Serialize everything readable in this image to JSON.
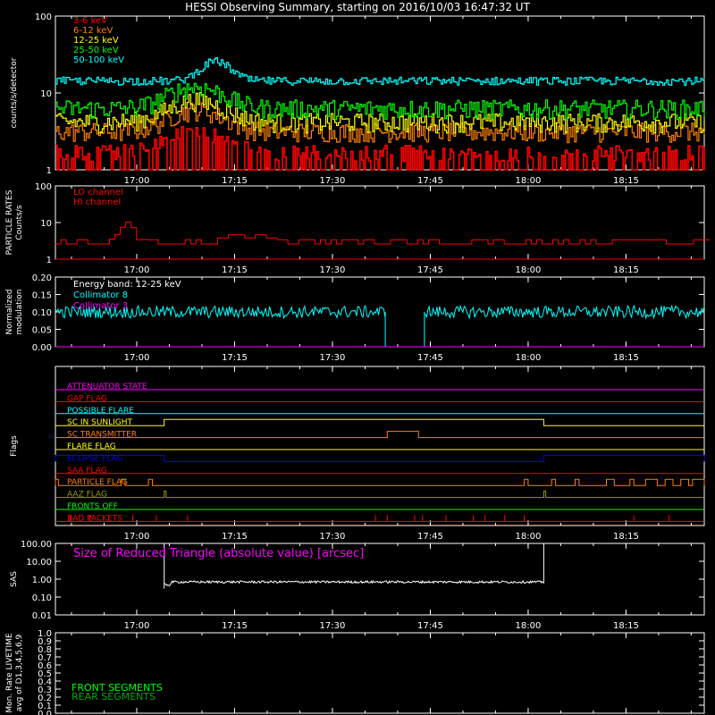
{
  "title": "HESSI Observing Summary, starting on 2016/10/03 16:47:32 UT",
  "time_ticks": [
    "17:00",
    "17:15",
    "17:30",
    "17:45",
    "18:00",
    "18:15"
  ],
  "colors": {
    "axis": "#ffffff",
    "red": "#ff0000",
    "orange": "#ff8000",
    "yellow": "#ffff00",
    "green": "#00ff00",
    "cyan": "#00ffff",
    "magenta": "#ff00ff",
    "blue": "#0000ff",
    "darkgreen": "#00aa00",
    "olive": "#999900"
  },
  "chart_data": [
    {
      "id": "counts",
      "type": "line",
      "ylabel": "counts/s/detector",
      "yscale": "log",
      "ylim": [
        1,
        100
      ],
      "yticks": [
        "1",
        "10",
        "100"
      ],
      "legend": [
        "3-6 keV",
        "6-12 keV",
        "12-25 keV",
        "25-50 keV",
        "50-100 keV"
      ],
      "series": [
        {
          "name": "3-6 keV",
          "color": "#ff0000",
          "base": 1.6
        },
        {
          "name": "6-12 keV",
          "color": "#ff8000",
          "base": 3.0
        },
        {
          "name": "12-25 keV",
          "color": "#ffff00",
          "base": 4.0
        },
        {
          "name": "25-50 keV",
          "color": "#00ff00",
          "base": 6.0
        },
        {
          "name": "50-100 keV",
          "color": "#00ffff",
          "base": 14.0
        }
      ]
    },
    {
      "id": "particle",
      "type": "line",
      "ylabel": "PARTICLE RATES",
      "ylabel2": "Counts/s",
      "yscale": "log",
      "ylim": [
        1,
        100
      ],
      "yticks": [
        "1",
        "10",
        "100"
      ],
      "legend": [
        "LO channel",
        "HI channel"
      ],
      "series": [
        {
          "name": "LO channel",
          "color": "#ff0000",
          "base": 2.4
        },
        {
          "name": "HI channel",
          "color": "#ff0000",
          "base": 1.0
        }
      ]
    },
    {
      "id": "modulation",
      "type": "line",
      "ylabel": "Normalized",
      "ylabel2": "modulation",
      "ylim": [
        0,
        0.2
      ],
      "yticks": [
        "0.00",
        "0.05",
        "0.10",
        "0.15",
        "0.20"
      ],
      "legend": [
        "Energy band: 12-25 keV",
        "Collimator 8",
        "Collimator 3"
      ],
      "series": [
        {
          "name": "Collimator 8",
          "color": "#00ffff",
          "base": 0.1
        },
        {
          "name": "Collimator 3",
          "color": "#ff00ff",
          "base": 0.0
        }
      ]
    },
    {
      "id": "flags",
      "type": "line",
      "ylabel": "Flags",
      "series": [
        {
          "name": "ATTENUATOR STATE",
          "color": "#ff00ff",
          "steps": []
        },
        {
          "name": "GAP FLAG",
          "color": "#ff0000",
          "steps": []
        },
        {
          "name": "POSSIBLE FLARE",
          "color": "#00ffff",
          "steps": []
        },
        {
          "name": "SC IN SUNLIGHT",
          "color": "#ffff00",
          "steps": [
            [
              17.07,
              18.04
            ]
          ]
        },
        {
          "name": "SC TRANSMITTER",
          "color": "#ff8000",
          "steps": [
            [
              17.64,
              17.72
            ]
          ]
        },
        {
          "name": "FLARE FLAG",
          "color": "#ffff00",
          "steps": []
        },
        {
          "name": "ECLIPSE FLAG",
          "color": "#0000ff",
          "steps": [
            [
              16.79,
              17.07
            ],
            [
              18.04,
              18.45
            ]
          ]
        },
        {
          "name": "SAA FLAG",
          "color": "#ff0000",
          "steps": []
        },
        {
          "name": "PARTICLE FLAG",
          "color": "#ff8000",
          "steps": [
            [
              16.79,
              16.8
            ],
            [
              16.96,
              16.97
            ],
            [
              17.03,
              17.04
            ],
            [
              17.99,
              18.0
            ],
            [
              18.06,
              18.07
            ],
            [
              18.12,
              18.13
            ],
            [
              18.2,
              18.22
            ],
            [
              18.26,
              18.27
            ],
            [
              18.3,
              18.33
            ],
            [
              18.35,
              18.37
            ],
            [
              18.39,
              18.41
            ],
            [
              18.42,
              18.45
            ]
          ]
        },
        {
          "name": "AAZ FLAG",
          "color": "#999900",
          "steps": [
            [
              17.07,
              17.075
            ],
            [
              18.04,
              18.045
            ]
          ]
        },
        {
          "name": "FRONTS OFF",
          "color": "#00ff00",
          "steps": []
        },
        {
          "name": "BAD PACKETS",
          "color": "#ff0000",
          "spikes": [
            16.83,
            16.88,
            16.99,
            17.05,
            17.13,
            17.61,
            17.64,
            17.71,
            17.73,
            17.79,
            17.86,
            17.89,
            17.94,
            17.99,
            18.27,
            18.36
          ]
        }
      ]
    },
    {
      "id": "sas",
      "type": "line",
      "ylabel": "SAS",
      "yscale": "log",
      "ylim": [
        0.01,
        100
      ],
      "yticks": [
        "0.01",
        "0.10",
        "1.00",
        "10.00",
        "100.00"
      ],
      "legend": [
        "Size of Reduced Triangle (absolute value) [arcsec]"
      ],
      "series": [
        {
          "name": "Size of Reduced Triangle (absolute value) [arcsec]",
          "color": "#ffffff",
          "base": 0.7
        }
      ]
    },
    {
      "id": "livetime",
      "type": "line",
      "ylabel": "Mon. Rate LIVETIME",
      "ylabel2": "avg of D1,3,4,5,6,9",
      "ylim": [
        0,
        1
      ],
      "yticks": [
        "0.0",
        "0.1",
        "0.2",
        "0.3",
        "0.4",
        "0.5",
        "0.6",
        "0.7",
        "0.8",
        "0.9",
        "1.0"
      ],
      "legend": [
        "FRONT SEGMENTS",
        "REAR SEGMENTS"
      ],
      "series": [
        {
          "name": "FRONT SEGMENTS",
          "color": "#00ff00"
        },
        {
          "name": "REAR SEGMENTS",
          "color": "#00aa00"
        }
      ]
    }
  ]
}
